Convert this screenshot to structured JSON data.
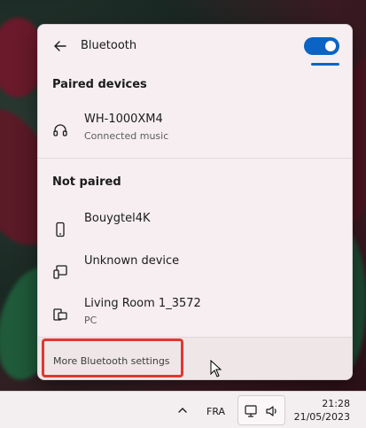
{
  "flyout": {
    "title": "Bluetooth",
    "toggle_on": true,
    "accent_color": "#0b63c4"
  },
  "paired_section": {
    "heading": "Paired devices",
    "devices": [
      {
        "name": "WH-1000XM4",
        "status": "Connected music",
        "icon": "headphones-icon"
      }
    ]
  },
  "unpaired_section": {
    "heading": "Not paired",
    "devices": [
      {
        "name": "Bouygtel4K",
        "status": "",
        "icon": "phone-icon"
      },
      {
        "name": "Unknown device",
        "status": "",
        "icon": "device-icon"
      },
      {
        "name": "Living Room 1_3572",
        "status": "PC",
        "icon": "pc-icon"
      }
    ]
  },
  "footer": {
    "more_settings_label": "More Bluetooth settings",
    "highlight_color": "#e0382f"
  },
  "taskbar": {
    "language": "FRA",
    "time": "21:28",
    "date": "21/05/2023"
  }
}
